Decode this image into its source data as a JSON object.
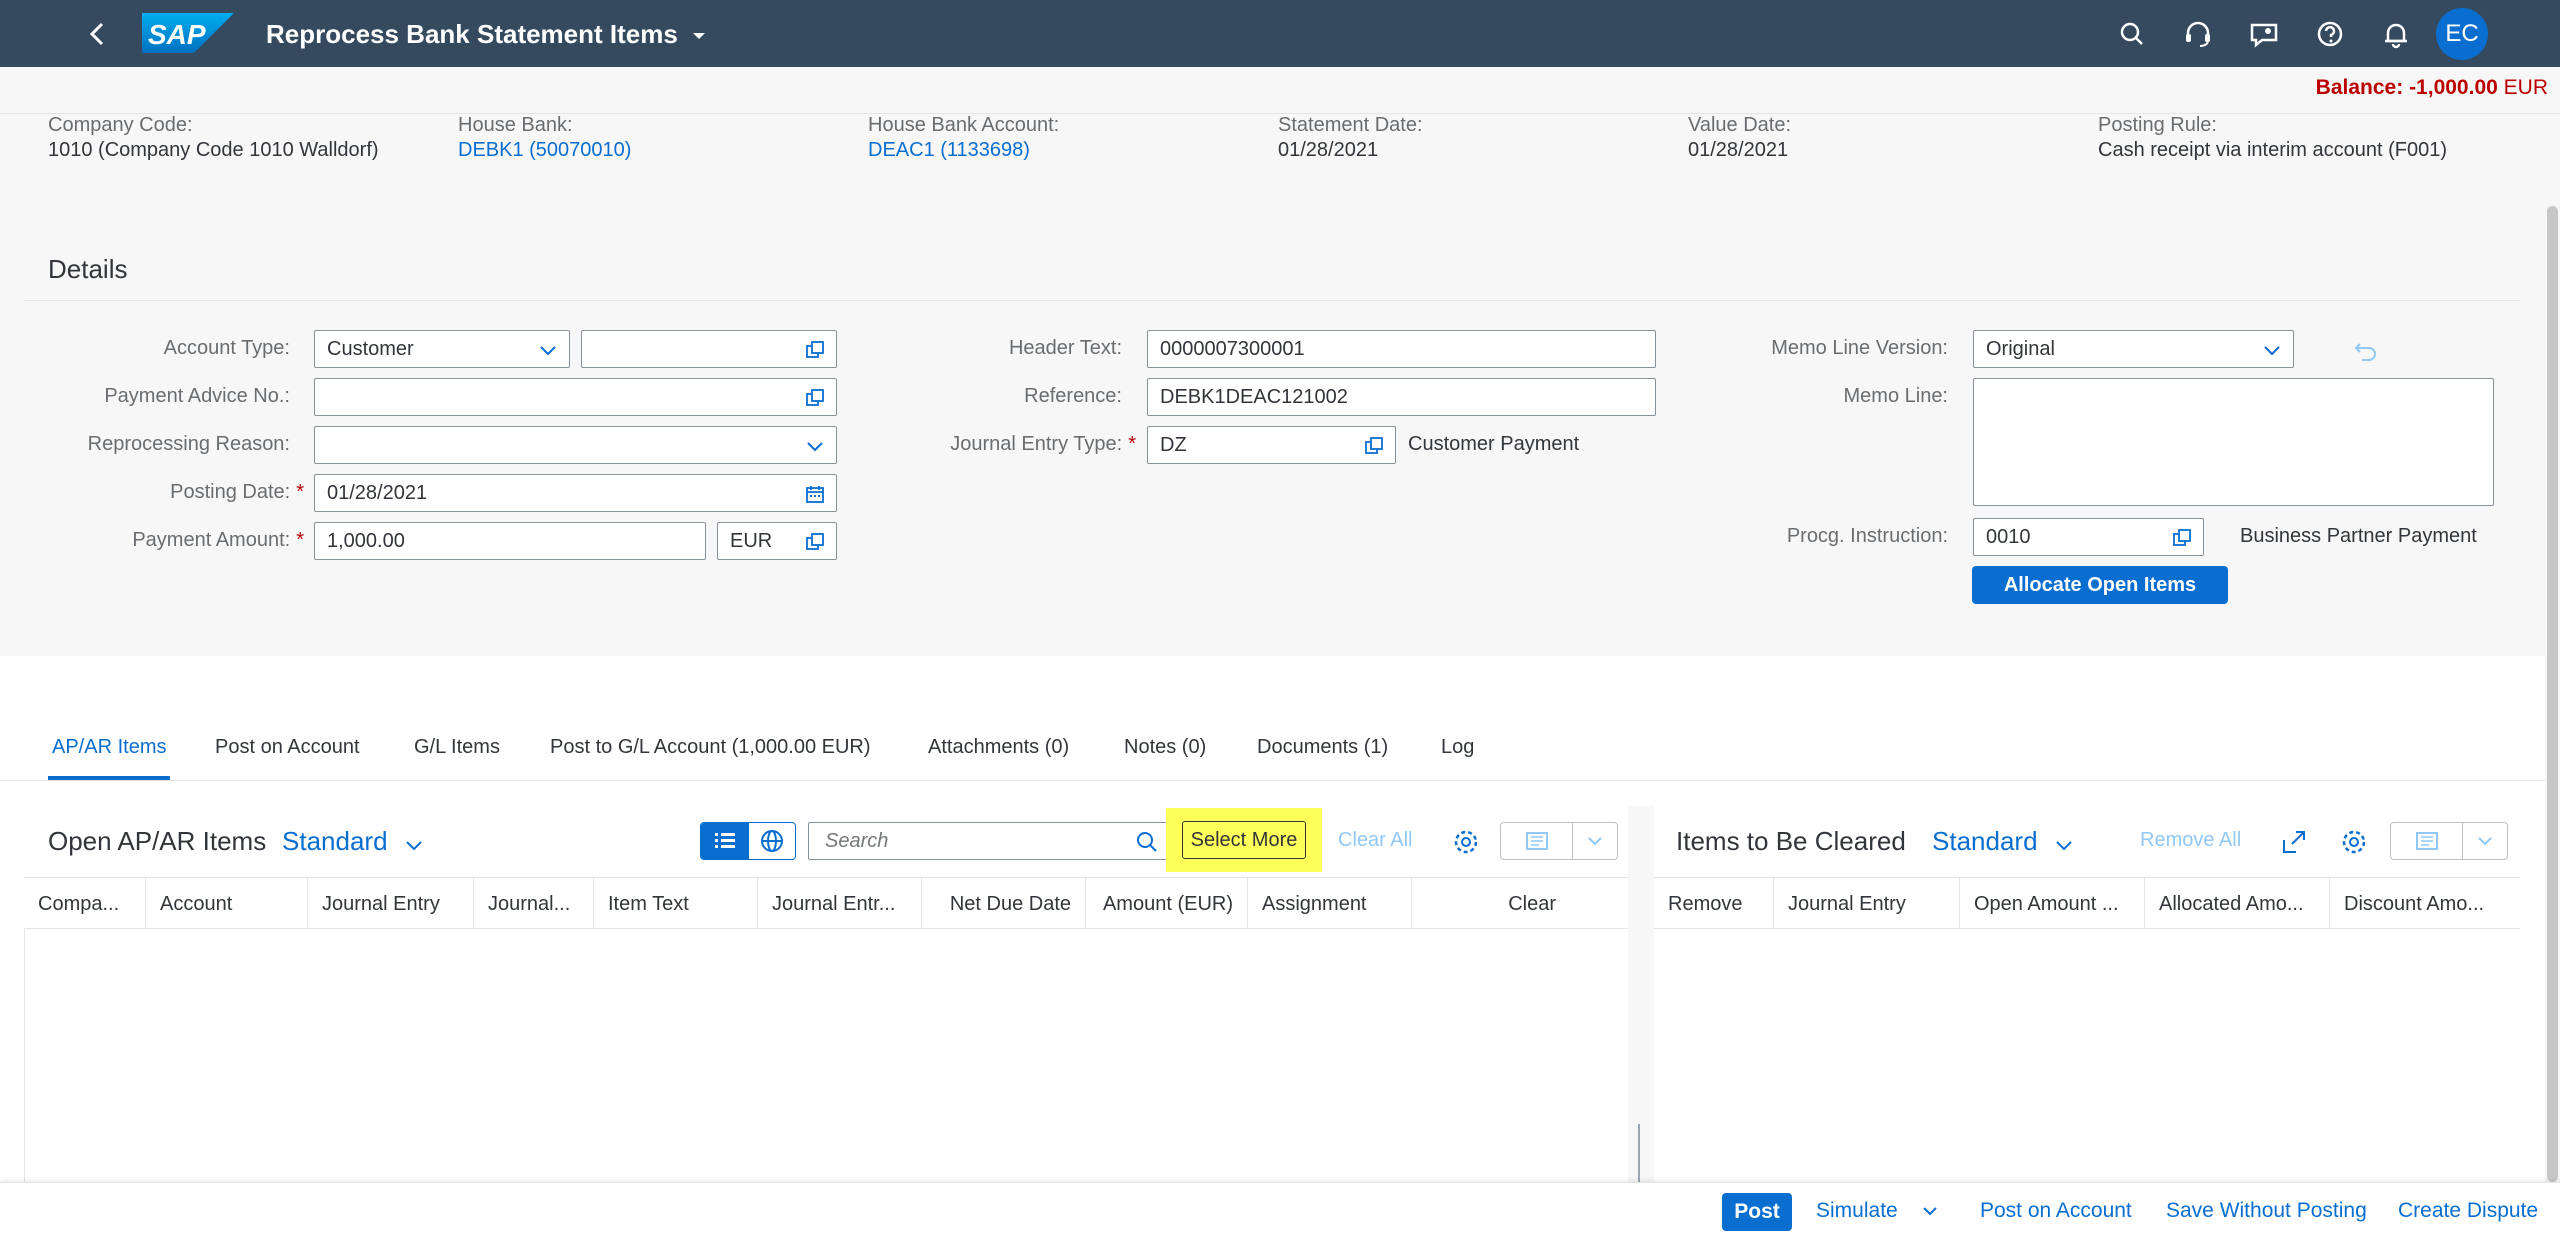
{
  "shell": {
    "app_title": "Reprocess Bank Statement Items",
    "logo_text": "SAP",
    "avatar_initials": "EC"
  },
  "balance": {
    "label": "Balance:",
    "amount": "-1,000.00",
    "currency": "EUR"
  },
  "header": {
    "company_code_label": "Company Code:",
    "company_code_value": "1010 (Company Code 1010 Walldorf)",
    "house_bank_label": "House Bank:",
    "house_bank_value": "DEBK1 (50070010)",
    "house_bank_account_label": "House Bank Account:",
    "house_bank_account_value": "DEAC1 (1133698)",
    "statement_date_label": "Statement Date:",
    "statement_date_value": "01/28/2021",
    "value_date_label": "Value Date:",
    "value_date_value": "01/28/2021",
    "posting_rule_label": "Posting Rule:",
    "posting_rule_value": "Cash receipt via interim account (F001)"
  },
  "details": {
    "title": "Details",
    "account_type_label": "Account Type:",
    "account_type_value": "Customer",
    "account_value": "",
    "payment_advice_label": "Payment Advice No.:",
    "payment_advice_value": "",
    "reprocessing_reason_label": "Reprocessing Reason:",
    "reprocessing_reason_value": "",
    "posting_date_label": "Posting Date:",
    "posting_date_value": "01/28/2021",
    "payment_amount_label": "Payment Amount:",
    "payment_amount_value": "1,000.00",
    "payment_currency_value": "EUR",
    "header_text_label": "Header Text:",
    "header_text_value": "0000007300001",
    "reference_label": "Reference:",
    "reference_value": "DEBK1DEAC121002",
    "journal_entry_type_label": "Journal Entry Type:",
    "journal_entry_type_value": "DZ",
    "journal_entry_type_desc": "Customer Payment",
    "memo_line_version_label": "Memo Line Version:",
    "memo_line_version_value": "Original",
    "memo_line_label": "Memo Line:",
    "memo_line_value": "",
    "procg_instruction_label": "Procg. Instruction:",
    "procg_instruction_value": "0010",
    "procg_instruction_desc": "Business Partner Payment",
    "allocate_button": "Allocate Open Items",
    "required_marker": "*"
  },
  "tabs": [
    {
      "label": "AP/AR Items"
    },
    {
      "label": "Post on Account"
    },
    {
      "label": "G/L Items"
    },
    {
      "label": "Post to G/L Account (1,000.00 EUR)"
    },
    {
      "label": "Attachments (0)"
    },
    {
      "label": "Notes (0)"
    },
    {
      "label": "Documents (1)"
    },
    {
      "label": "Log"
    }
  ],
  "open_items": {
    "title": "Open AP/AR Items",
    "variant": "Standard",
    "search_placeholder": "Search",
    "select_more": "Select More",
    "clear_all": "Clear All",
    "columns": [
      "Compa...",
      "Account",
      "Journal Entry",
      "Journal...",
      "Item Text",
      "Journal Entr...",
      "Net Due Date",
      "Amount (EUR)",
      "Assignment",
      "Clear"
    ]
  },
  "cleared_items": {
    "title": "Items to Be Cleared",
    "variant": "Standard",
    "remove_all": "Remove All",
    "columns": [
      "Remove",
      "Journal Entry",
      "Open Amount ...",
      "Allocated Amo...",
      "Discount Amo..."
    ]
  },
  "footer": {
    "post": "Post",
    "simulate": "Simulate",
    "post_on_account": "Post on Account",
    "save_without_posting": "Save Without Posting",
    "create_dispute": "Create Dispute"
  },
  "colors": {
    "shell": "#354a5f",
    "accent": "#0a6ed1",
    "required": "#bb0000",
    "highlight": "#ffff5a"
  }
}
